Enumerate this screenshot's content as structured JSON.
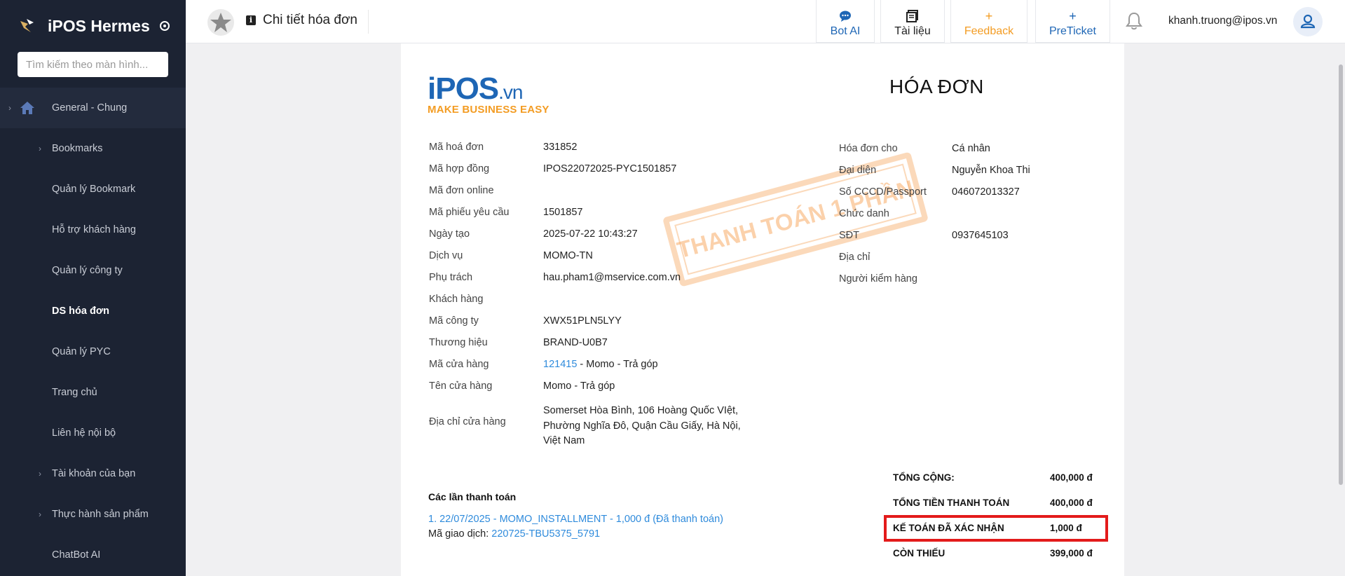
{
  "app": {
    "name": "iPOS Hermes"
  },
  "sidebar": {
    "search_placeholder": "Tìm kiếm theo màn hình...",
    "items": [
      {
        "label": "General - Chung"
      },
      {
        "label": "Bookmarks"
      },
      {
        "label": "Quản lý Bookmark"
      },
      {
        "label": "Hỗ trợ khách hàng"
      },
      {
        "label": "Quản lý công ty"
      },
      {
        "label": "DS hóa đơn"
      },
      {
        "label": "Quản lý PYC"
      },
      {
        "label": "Trang chủ"
      },
      {
        "label": "Liên hệ nội bộ"
      },
      {
        "label": "Tài khoản của bạn"
      },
      {
        "label": "Thực hành sản phẩm"
      },
      {
        "label": "ChatBot AI"
      }
    ]
  },
  "header": {
    "page_title": "Chi tiết hóa đơn",
    "buttons": [
      {
        "label": "Bot AI",
        "icon": "chat-bubble-icon",
        "color": "#1e66b5"
      },
      {
        "label": "Tài liệu",
        "icon": "document-icon",
        "color": "#222222"
      },
      {
        "label": "Feedback",
        "icon": "plus-icon",
        "color": "#f39c23"
      },
      {
        "label": "PreTicket",
        "icon": "plus-icon",
        "color": "#1e66b5"
      }
    ],
    "user_email": "khanh.truong@ipos.vn"
  },
  "invoice": {
    "logo_main": "iPOS",
    "logo_suffix": ".vn",
    "logo_tagline": "MAKE BUSINESS EASY",
    "heading": "HÓA ĐƠN",
    "stamp_text": "THANH TOÁN 1 PHẦN",
    "left_fields": [
      {
        "label": "Mã hoá đơn",
        "value": "331852"
      },
      {
        "label": "Mã hợp đồng",
        "value": "IPOS22072025-PYC1501857"
      },
      {
        "label": "Mã đơn online",
        "value": ""
      },
      {
        "label": "Mã phiếu yêu cầu",
        "value": "1501857"
      },
      {
        "label": "Ngày tạo",
        "value": "2025-07-22 10:43:27"
      },
      {
        "label": "Dịch vụ",
        "value": "MOMO-TN"
      },
      {
        "label": "Phụ trách",
        "value": "hau.pham1@mservice.com.vn"
      },
      {
        "label": "Khách hàng",
        "value": ""
      },
      {
        "label": "Mã công ty",
        "value": "XWX51PLN5LYY"
      },
      {
        "label": "Thương hiệu",
        "value": "BRAND-U0B7"
      },
      {
        "label": "Mã cửa hàng",
        "value": "121415",
        "suffix": " - Momo - Trả góp"
      },
      {
        "label": "Tên cửa hàng",
        "value": "Momo - Trả góp"
      },
      {
        "label": "Địa chỉ cửa hàng",
        "value": "Somerset Hòa Bình, 106 Hoàng Quốc VIệt, Phường Nghĩa Đô, Quận Cầu Giấy, Hà Nội, Việt Nam"
      }
    ],
    "right_fields": [
      {
        "label": "Hóa đơn cho",
        "value": "Cá nhân"
      },
      {
        "label": "Đại diện",
        "value": "Nguyễn Khoa Thi"
      },
      {
        "label": "Số CCCD/Passport",
        "value": "046072013327"
      },
      {
        "label": "Chức danh",
        "value": ""
      },
      {
        "label": "SĐT",
        "value": "0937645103"
      },
      {
        "label": "Địa chỉ",
        "value": ""
      },
      {
        "label": "Người kiểm hàng",
        "value": ""
      }
    ],
    "payments": {
      "title": "Các lần thanh toán",
      "line": "1. 22/07/2025 - MOMO_INSTALLMENT - 1,000 đ (Đã thanh toán)",
      "code_label": "Mã giao dịch:",
      "code_value": "220725-TBU5375_5791"
    },
    "totals": [
      {
        "label": "TỔNG CỘNG:",
        "value": "400,000 đ"
      },
      {
        "label": "TỔNG TIỀN THANH TOÁN",
        "value": "400,000 đ"
      },
      {
        "label": "KẾ TOÁN ĐÃ XÁC NHẬN",
        "value": "1,000 đ"
      },
      {
        "label": "CÒN THIẾU",
        "value": "399,000 đ"
      }
    ]
  },
  "colors": {
    "sidebar_bg": "#1c2333",
    "link": "#2f8bdc",
    "accent_orange": "#f39c23",
    "highlight_border": "#e31b1b"
  }
}
